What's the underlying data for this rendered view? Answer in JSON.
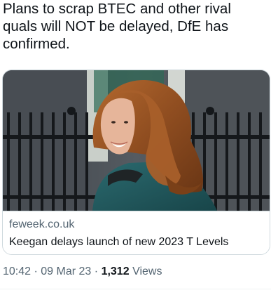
{
  "tweet": {
    "text_line1": "Plans to scrap BTEC and other rival",
    "text_line2": "quals will NOT be delayed, DfE has",
    "text_line3": "confirmed."
  },
  "link_card": {
    "domain": "feweek.co.uk",
    "title": "Keegan delays launch of new 2023 T Levels"
  },
  "meta": {
    "time": "10:42",
    "separator": "·",
    "date": "09 Mar 23",
    "views_count": "1,312",
    "views_label": "Views"
  },
  "colors": {
    "text": "#0f1419",
    "secondary": "#536471",
    "border": "#cfd9de"
  }
}
